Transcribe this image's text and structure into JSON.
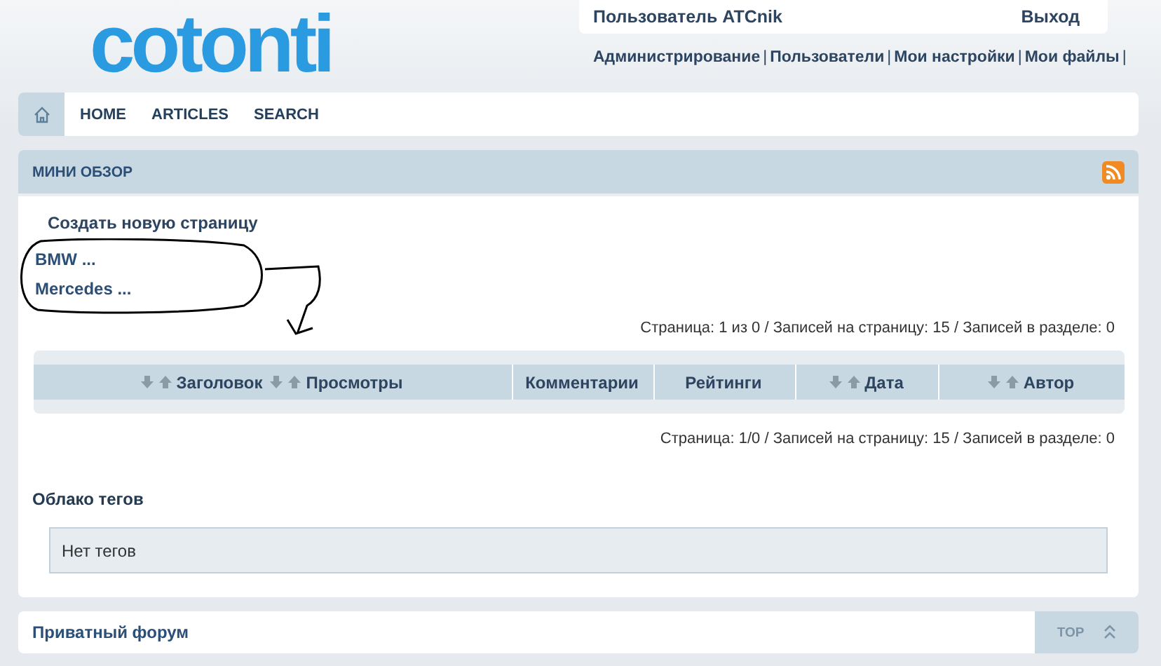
{
  "logo": {
    "text": "cotonti"
  },
  "user_box": {
    "user": "Пользователь ATCnik",
    "logout": "Выход"
  },
  "user_links": {
    "items": [
      "Администрирование",
      "Пользователи",
      "Мои настройки",
      "Мои файлы"
    ],
    "separator": "|"
  },
  "nav": {
    "items": [
      "HOME",
      "ARTICLES",
      "SEARCH"
    ]
  },
  "panel": {
    "title": "МИНИ ОБЗОР",
    "create_link": "Создать новую страницу",
    "pages": [
      "BMW ...",
      "Mercedes ..."
    ],
    "pagination_top": "Страница: 1 из 0 / Записей на страницу: 15 / Записей в разделе: 0",
    "table": {
      "columns": [
        {
          "fields": [
            "Заголовок",
            "Просмотры"
          ],
          "sortable": true
        },
        {
          "fields": [
            "Комментарии"
          ],
          "sortable": false
        },
        {
          "fields": [
            "Рейтинги"
          ],
          "sortable": false
        },
        {
          "fields": [
            "Дата"
          ],
          "sortable": true
        },
        {
          "fields": [
            "Автор"
          ],
          "sortable": true
        }
      ]
    },
    "pagination_bottom": "Страница: 1/0 / Записей на страницу: 15 / Записей в разделе: 0",
    "tags_title": "Облако тегов",
    "tags_empty": "Нет тегов"
  },
  "footer": {
    "title": "Приватный форум",
    "top_button": "TOP"
  }
}
